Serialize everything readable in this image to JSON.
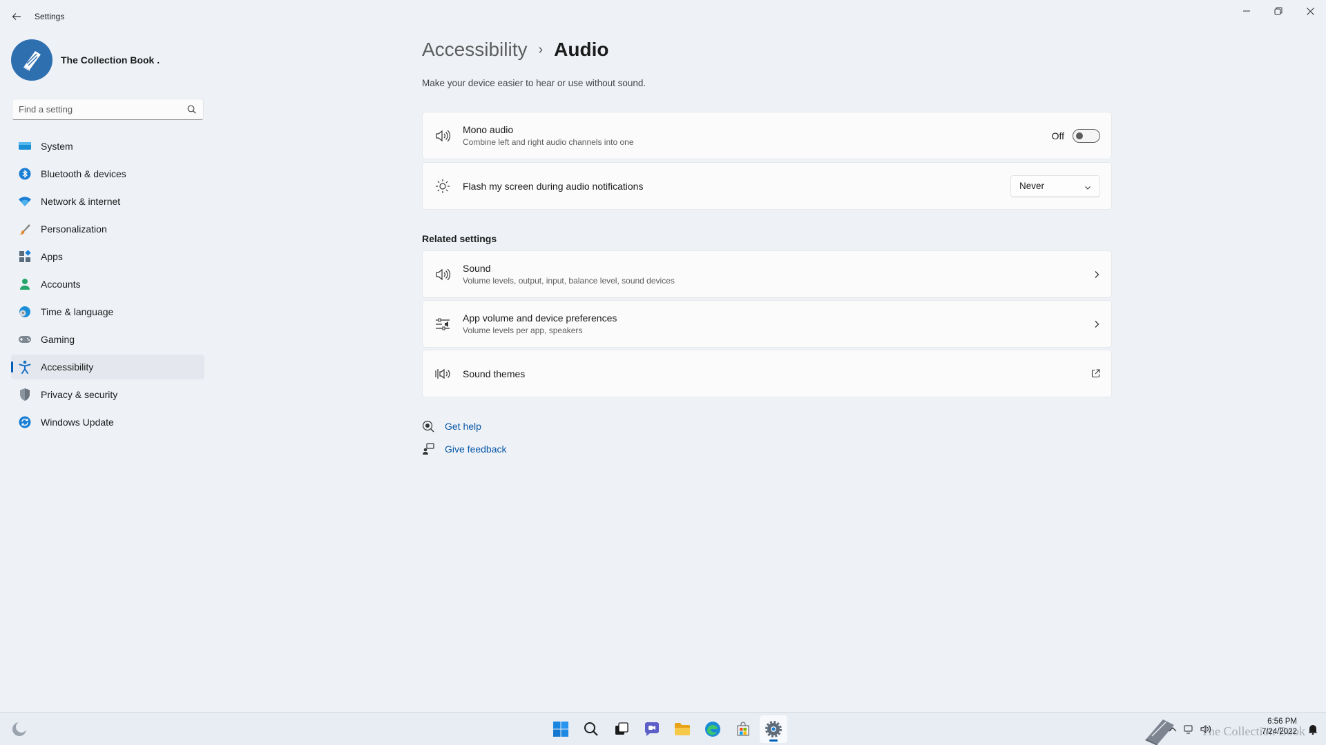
{
  "window": {
    "title": "Settings"
  },
  "profile": {
    "name": "The Collection Book ."
  },
  "search": {
    "placeholder": "Find a setting"
  },
  "sidebar": {
    "items": [
      {
        "label": "System"
      },
      {
        "label": "Bluetooth & devices"
      },
      {
        "label": "Network & internet"
      },
      {
        "label": "Personalization"
      },
      {
        "label": "Apps"
      },
      {
        "label": "Accounts"
      },
      {
        "label": "Time & language"
      },
      {
        "label": "Gaming"
      },
      {
        "label": "Accessibility",
        "active": true
      },
      {
        "label": "Privacy & security"
      },
      {
        "label": "Windows Update"
      }
    ]
  },
  "breadcrumb": {
    "parent": "Accessibility",
    "separator": "›",
    "current": "Audio"
  },
  "page": {
    "description": "Make your device easier to hear or use without sound."
  },
  "settings": {
    "mono_audio": {
      "title": "Mono audio",
      "subtitle": "Combine left and right audio channels into one",
      "state_label": "Off"
    },
    "flash_screen": {
      "title": "Flash my screen during audio notifications",
      "selected": "Never"
    }
  },
  "related": {
    "title": "Related settings",
    "sound": {
      "title": "Sound",
      "subtitle": "Volume levels, output, input, balance level, sound devices"
    },
    "app_volume": {
      "title": "App volume and device preferences",
      "subtitle": "Volume levels per app, speakers"
    },
    "sound_themes": {
      "title": "Sound themes"
    }
  },
  "links": {
    "help": "Get help",
    "feedback": "Give feedback"
  },
  "taskbar": {
    "clock": {
      "time": "6:56 PM",
      "date": "7/24/2022"
    },
    "watermark": "The Collection Book"
  },
  "colors": {
    "accent": "#005fb8",
    "link": "#0a57a6",
    "background": "#eef2f7"
  }
}
